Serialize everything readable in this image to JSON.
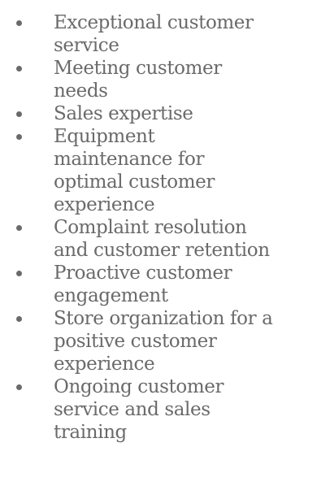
{
  "bullet_list": {
    "items": [
      "Exceptional customer service",
      "Meeting customer needs",
      "Sales expertise",
      "Equipment maintenance for optimal customer experience",
      "Complaint resolution and customer retention",
      "Proactive customer engagement",
      "Store organization for a positive customer experience",
      "Ongoing customer service and sales training"
    ]
  },
  "colors": {
    "text": "#6a6a6a",
    "background": "#ffffff"
  }
}
